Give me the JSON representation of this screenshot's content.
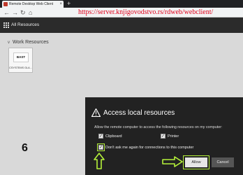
{
  "browser": {
    "tab_title": "Remote Desktop Web Client",
    "tab_close": "×",
    "new_tab": "+",
    "back": "←",
    "forward": "→",
    "reload": "↻",
    "home": "⌂",
    "url": "https://server.knjigovodstvo.rs/rdweb/webclient/"
  },
  "app": {
    "title": "All Resources"
  },
  "section": {
    "chevron": "v",
    "title": "Work Resources"
  },
  "tiles": [
    {
      "logo": "BAST",
      "label": "CSYSTEMS GLA..."
    }
  ],
  "annotation": {
    "step": "6",
    "highlight_color": "#b5f23a"
  },
  "dialog": {
    "title": "Access local resources",
    "description": "Allow the remote computer to access the following resources on my computer:",
    "clipboard": {
      "label": "Clipboard",
      "checked": true
    },
    "printer": {
      "label": "Printer",
      "checked": true
    },
    "dont_ask": {
      "label": "Don't ask me again for connections to this computer",
      "checked": true
    },
    "check_mark": "✓",
    "allow_label": "Allow",
    "cancel_label": "Cancel"
  }
}
